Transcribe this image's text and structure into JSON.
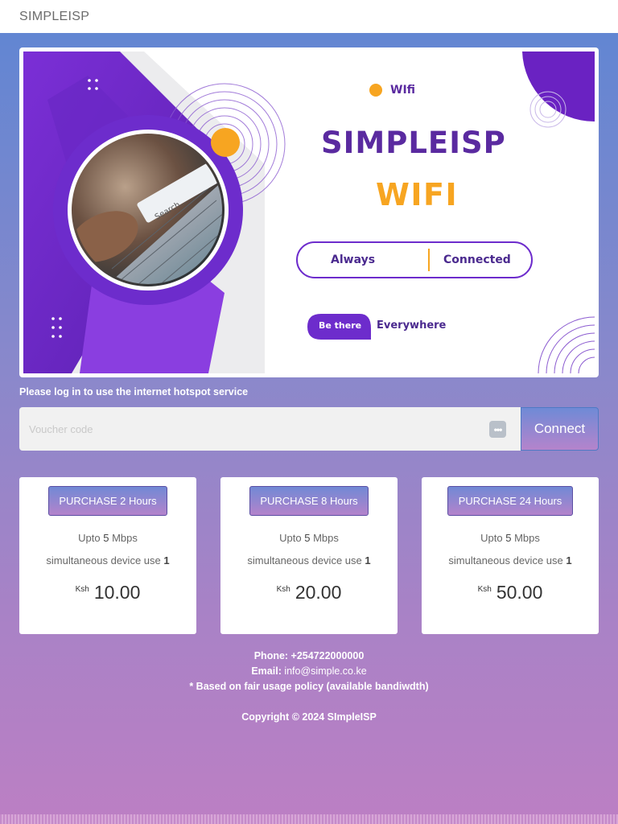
{
  "app": {
    "title": "SIMPLEISP"
  },
  "banner": {
    "wifi_small": "WIfi",
    "brand_title": "SIMPLEISP",
    "brand_wifi": "WIFI",
    "pill_left": "Always",
    "pill_right": "Connected",
    "be_there": "Be there",
    "everywhere": "Everywhere",
    "search_text": "Search..."
  },
  "login": {
    "message": "Please log in to use the internet hotspot service",
    "voucher_placeholder": "Voucher code",
    "voucher_value": "",
    "connect_label": "Connect"
  },
  "plans": [
    {
      "button": "PURCHASE 2 Hours",
      "speed_prefix": "Upto ",
      "speed_value": "5",
      "speed_unit": " Mbps",
      "device_label": "simultaneous device use ",
      "device_count": "1",
      "currency": "Ksh",
      "price": "10.00"
    },
    {
      "button": "PURCHASE 8 Hours",
      "speed_prefix": "Upto ",
      "speed_value": "5",
      "speed_unit": " Mbps",
      "device_label": "simultaneous device use ",
      "device_count": "1",
      "currency": "Ksh",
      "price": "20.00"
    },
    {
      "button": "PURCHASE 24 Hours",
      "speed_prefix": "Upto ",
      "speed_value": "5",
      "speed_unit": " Mbps",
      "device_label": "simultaneous device use ",
      "device_count": "1",
      "currency": "Ksh",
      "price": "50.00"
    }
  ],
  "footer": {
    "phone_label": "Phone:",
    "phone_value": " +254722000000",
    "email_label": "Email:",
    "email_value": " info@simple.co.ke",
    "policy": "* Based on fair usage policy (available bandiwdth)",
    "copyright": "Copyright © 2024 SImpleISP"
  },
  "colors": {
    "brand_purple": "#5a2aa0",
    "brand_orange": "#f7a521",
    "bg_top": "#5e86d3",
    "bg_bottom": "#bc7fc4"
  },
  "icons": {
    "keyboard": "keyboard-icon"
  }
}
